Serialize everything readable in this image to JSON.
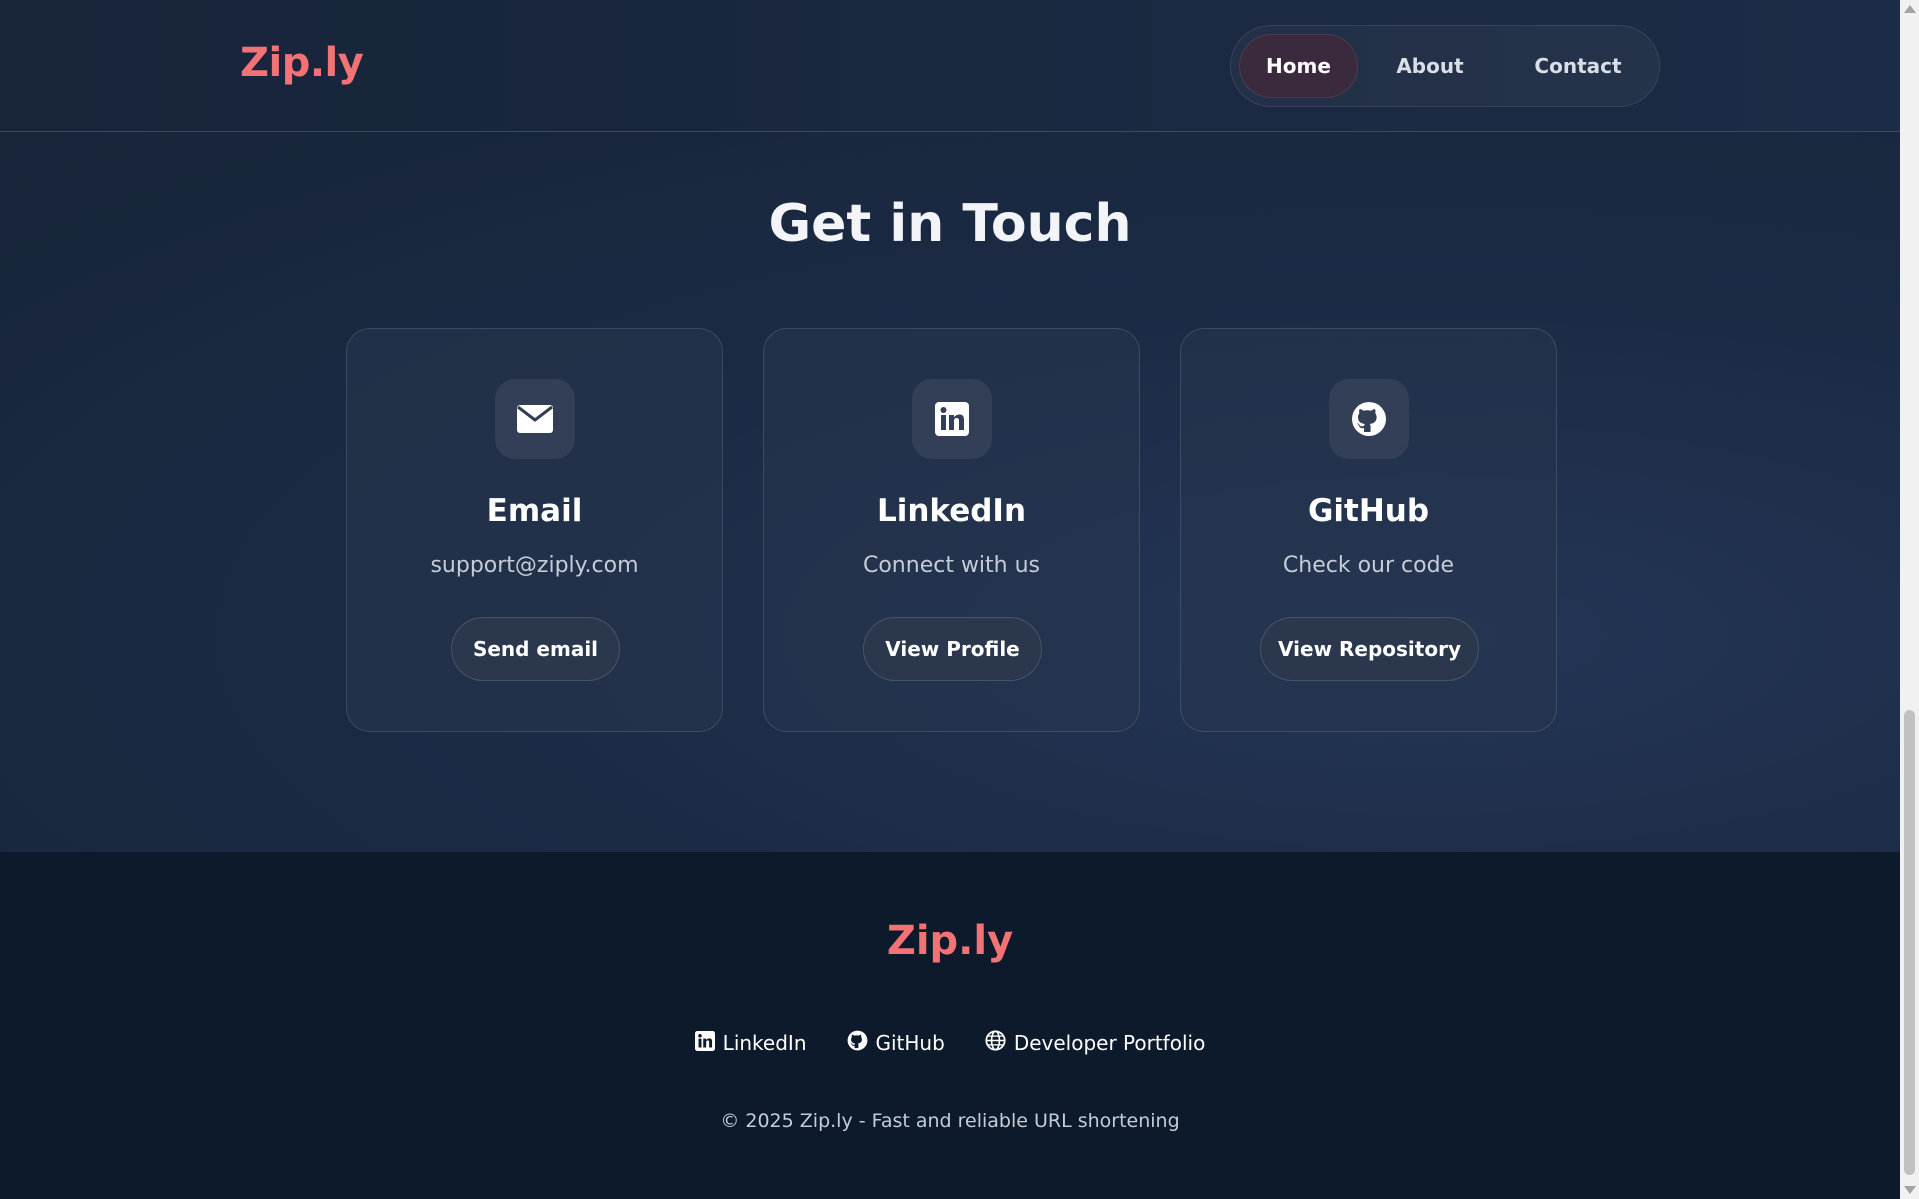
{
  "header": {
    "logo": "Zip.ly",
    "nav": [
      {
        "label": "Home",
        "active": true
      },
      {
        "label": "About",
        "active": false
      },
      {
        "label": "Contact",
        "active": false
      }
    ]
  },
  "contact": {
    "title": "Get in Touch",
    "cards": [
      {
        "icon": "envelope-icon",
        "title": "Email",
        "text": "support@ziply.com",
        "button": "Send email"
      },
      {
        "icon": "linkedin-icon",
        "title": "LinkedIn",
        "text": "Connect with us",
        "button": "View Profile"
      },
      {
        "icon": "github-icon",
        "title": "GitHub",
        "text": "Check our code",
        "button": "View Repository"
      }
    ]
  },
  "footer": {
    "logo": "Zip.ly",
    "links": [
      {
        "icon": "linkedin-icon",
        "label": "LinkedIn"
      },
      {
        "icon": "github-icon",
        "label": "GitHub"
      },
      {
        "icon": "globe-icon",
        "label": "Developer Portfolio"
      }
    ],
    "copyright": "© 2025 Zip.ly - Fast and reliable URL shortening"
  },
  "colors": {
    "brand": "#f27275",
    "background": "#1b2a41",
    "footer_bg": "#0c1a2b",
    "card_bg": "#28364e",
    "active_nav": "#3b2a3e"
  }
}
